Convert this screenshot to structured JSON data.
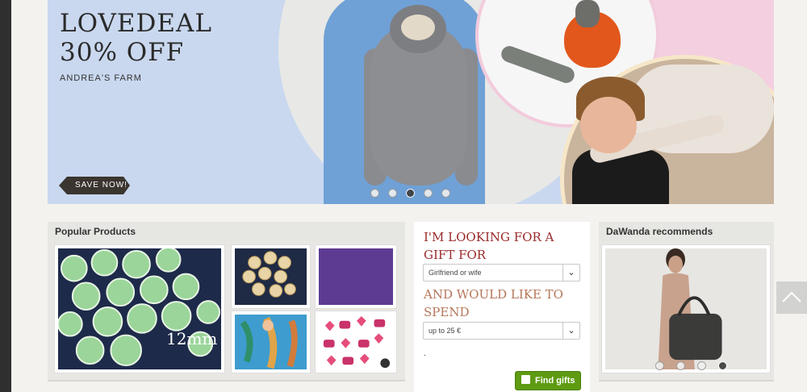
{
  "banner": {
    "title": "LOVEDEAL\n30% OFF",
    "subtitle": "ANDREA'S FARM",
    "save_label": "SAVE NOW!",
    "slides": 5,
    "active_slide": 3
  },
  "popular": {
    "heading": "Popular Products",
    "tiles": [
      {
        "icon": "green-cabochons-image",
        "caption": "12mm"
      },
      {
        "icon": "gold-buttons-image",
        "caption": ""
      },
      {
        "icon": "purple-fabric-image",
        "caption": ""
      },
      {
        "icon": "mermaid-fabric-image",
        "caption": ""
      },
      {
        "icon": "cupcake-fabric-image",
        "caption": ""
      }
    ]
  },
  "gift": {
    "heading1": "I'M LOOKING FOR A GIFT FOR",
    "recipient_value": "Girlfriend or wife",
    "heading2": "AND WOULD LIKE TO SPEND",
    "budget_value": "up to 25 €",
    "dot": ".",
    "find_label": "Find gifts"
  },
  "recommends": {
    "heading": "DaWanda recommends",
    "slides": 4,
    "active_slide": 4
  },
  "colors": {
    "accent_red": "#9a2a2a",
    "find_green": "#5e9b12",
    "banner_blue": "#c9d8ef"
  }
}
